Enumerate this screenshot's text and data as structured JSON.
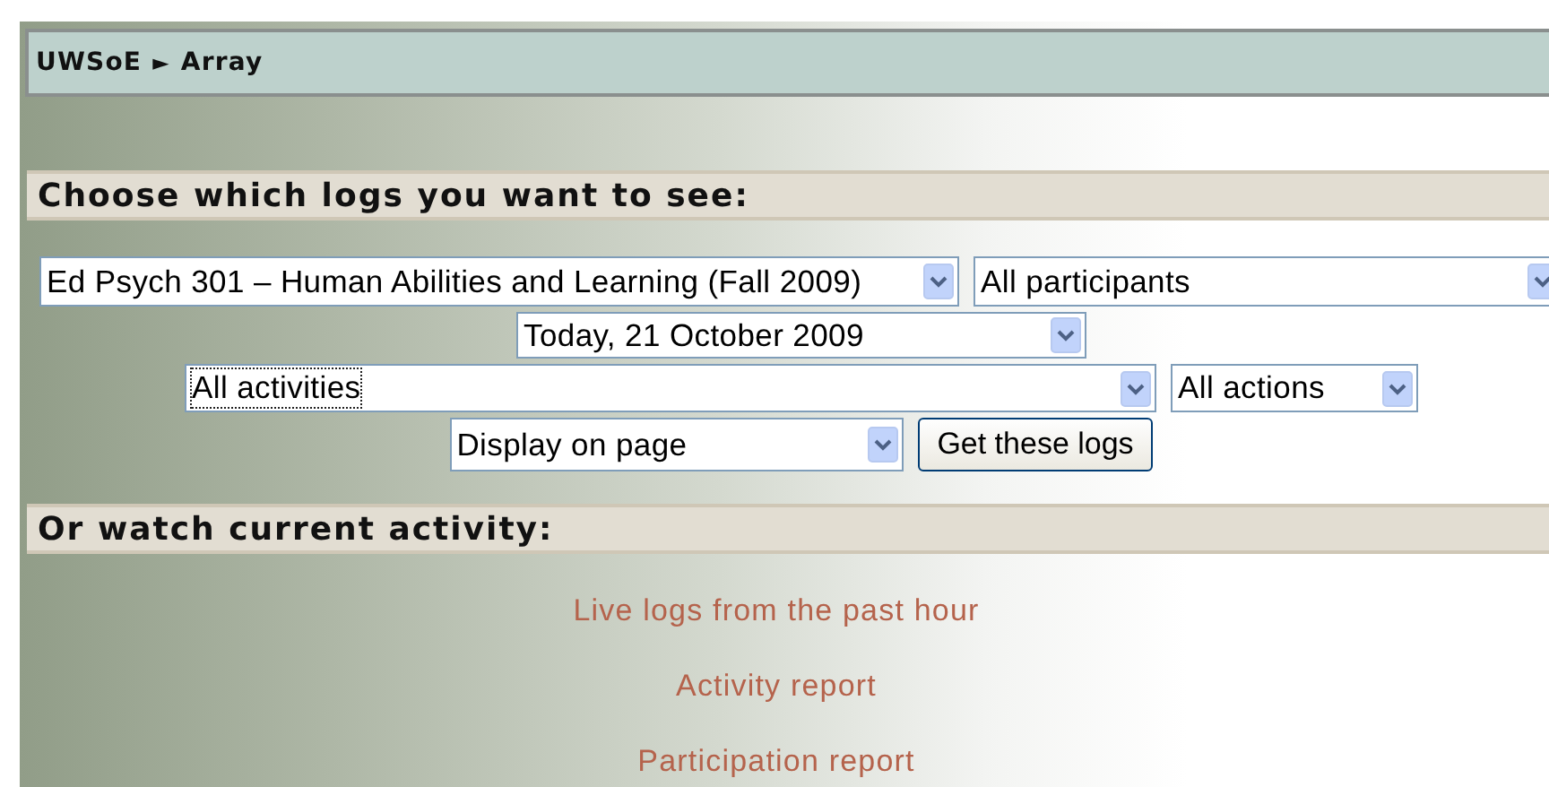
{
  "breadcrumb": {
    "items": [
      "UWSoE",
      "Array"
    ],
    "separator": "►"
  },
  "log_filter": {
    "heading": "Choose which logs you want to see:",
    "rows": [
      [
        {
          "value": "Ed Psych 301 – Human Abilities and Learning (Fall 2009)",
          "focused": false
        },
        {
          "value": "All participants",
          "focused": false
        }
      ],
      [
        {
          "value": "Today, 21 October 2009",
          "focused": false
        }
      ],
      [
        {
          "value": "All activities",
          "focused": true
        },
        {
          "value": "All actions",
          "focused": false
        }
      ],
      [
        {
          "value": "Display on page",
          "focused": false
        }
      ]
    ],
    "button": "Get these logs"
  },
  "current_activity": {
    "heading": "Or watch current activity:",
    "links": [
      "Live logs from the past hour",
      "Activity report",
      "Participation report"
    ]
  }
}
